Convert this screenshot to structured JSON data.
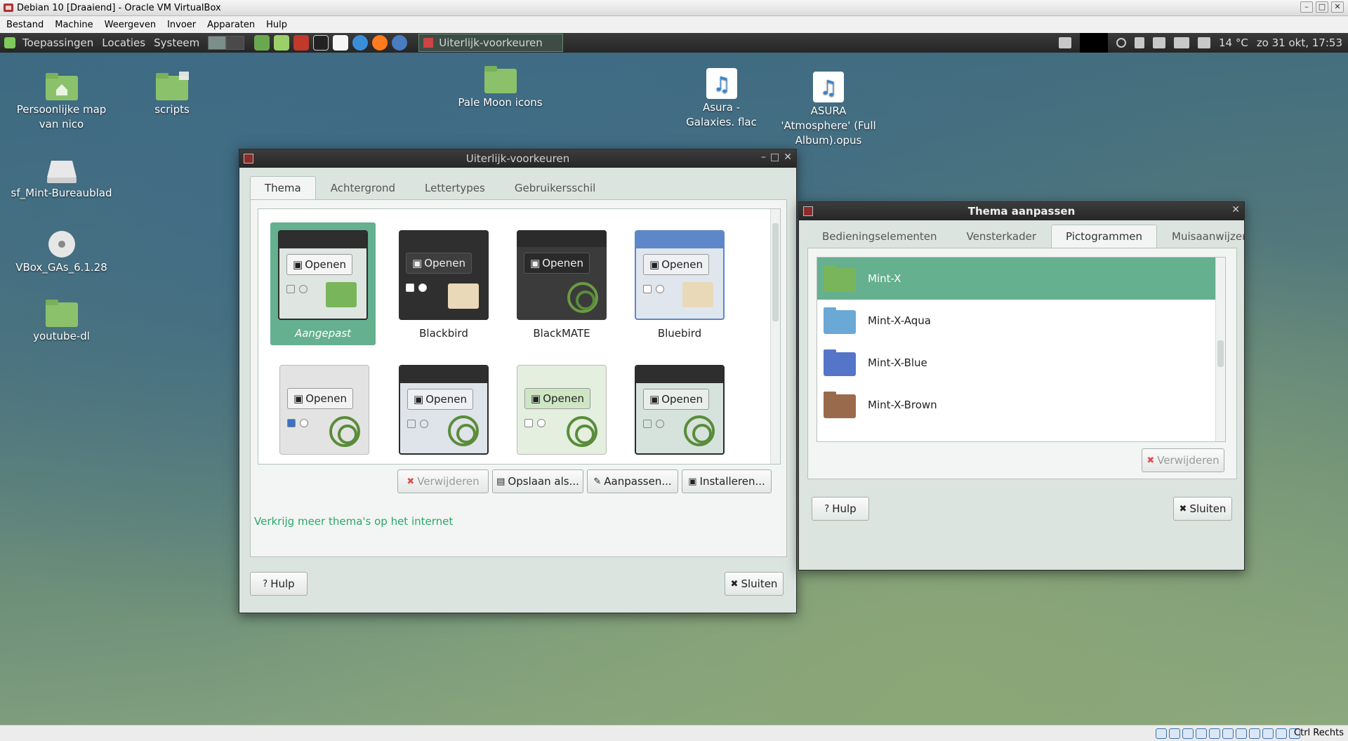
{
  "host": {
    "title": "Debian 10 [Draaiend] - Oracle VM VirtualBox",
    "menu": [
      "Bestand",
      "Machine",
      "Weergeven",
      "Invoer",
      "Apparaten",
      "Hulp"
    ],
    "status_key": "Ctrl Rechts"
  },
  "panel": {
    "menus": [
      "Toepassingen",
      "Locaties",
      "Systeem"
    ],
    "task": "Uiterlijk-voorkeuren",
    "weather": "14 °C",
    "clock": "zo 31 okt, 17:53"
  },
  "desktop_icons": [
    {
      "label": "Persoonlijke map van nico"
    },
    {
      "label": "scripts"
    },
    {
      "label": "sf_Mint-Bureaublad"
    },
    {
      "label": "VBox_GAs_6.1.28"
    },
    {
      "label": "youtube-dl"
    },
    {
      "label": "Pale Moon icons"
    },
    {
      "label": "Asura - Galaxies. flac"
    },
    {
      "label": "ASURA 'Atmosphere' (Full Album).opus"
    }
  ],
  "appearance": {
    "title": "Uiterlijk-voorkeuren",
    "tabs": [
      "Thema",
      "Achtergrond",
      "Lettertypes",
      "Gebruikersschil"
    ],
    "themes": [
      {
        "name": "Aangepast",
        "open": "Openen"
      },
      {
        "name": "Blackbird",
        "open": "Openen"
      },
      {
        "name": "BlackMATE",
        "open": "Openen"
      },
      {
        "name": "Bluebird",
        "open": "Openen"
      },
      {
        "name": "",
        "open": "Openen"
      },
      {
        "name": "",
        "open": "Openen"
      },
      {
        "name": "",
        "open": "Openen"
      },
      {
        "name": "",
        "open": "Openen"
      }
    ],
    "buttons": {
      "remove": "Verwijderen",
      "save_as": "Opslaan als...",
      "customize": "Aanpassen...",
      "install": "Installeren...",
      "help": "Hulp",
      "close": "Sluiten"
    },
    "more_link": "Verkrijg meer thema's op het internet"
  },
  "customize": {
    "title": "Thema aanpassen",
    "tabs": [
      "Bedieningselementen",
      "Vensterkader",
      "Pictogrammen",
      "Muisaanwijzer"
    ],
    "icons": [
      {
        "name": "Mint-X",
        "color": "#79b55a"
      },
      {
        "name": "Mint-X-Aqua",
        "color": "#6aa8d6"
      },
      {
        "name": "Mint-X-Blue",
        "color": "#5575c9"
      },
      {
        "name": "Mint-X-Brown",
        "color": "#9a6a4c"
      }
    ],
    "buttons": {
      "remove": "Verwijderen",
      "help": "Hulp",
      "close": "Sluiten"
    }
  }
}
